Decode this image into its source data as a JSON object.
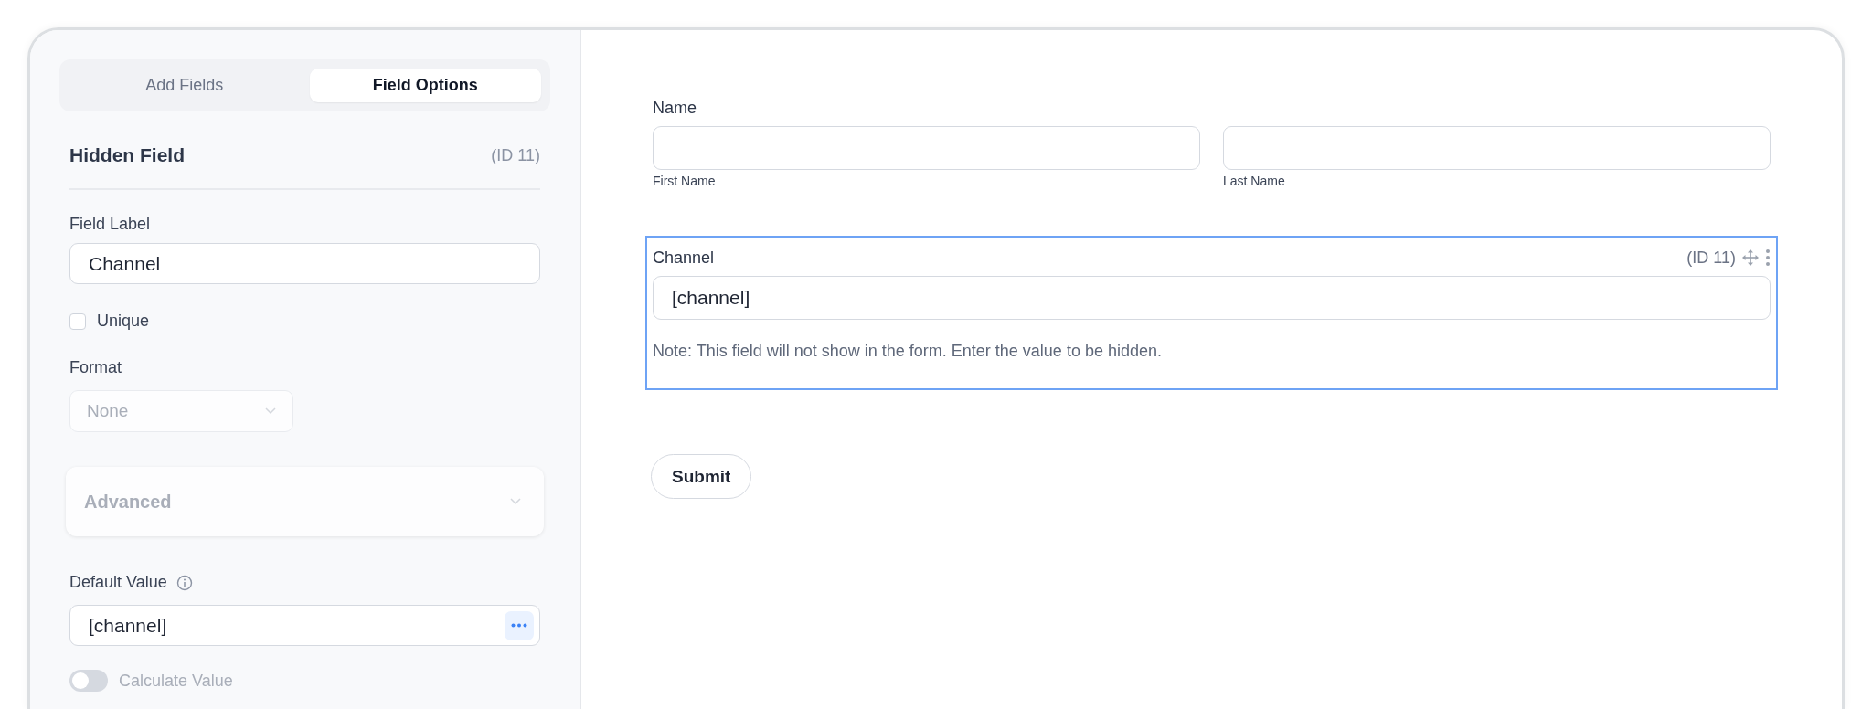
{
  "sidebar": {
    "tabs": [
      {
        "label": "Add Fields",
        "selected": false
      },
      {
        "label": "Field Options",
        "selected": true
      }
    ],
    "field_title": "Hidden Field",
    "field_id": "(ID 11)",
    "field_label": {
      "label": "Field Label",
      "value": "Channel"
    },
    "unique": {
      "label": "Unique",
      "checked": false
    },
    "format": {
      "label": "Format",
      "value": "None",
      "disabled": true
    },
    "advanced": {
      "label": "Advanced",
      "expanded": false,
      "disabled": true
    },
    "default_value": {
      "label": "Default Value",
      "value": "[channel]"
    },
    "calculate_value": {
      "label": "Calculate Value",
      "on": false
    }
  },
  "form": {
    "fields": [
      {
        "kind": "name",
        "label": "Name",
        "selected": false,
        "subfields": [
          {
            "sublabel": "First Name"
          },
          {
            "sublabel": "Last Name"
          }
        ]
      },
      {
        "kind": "hidden",
        "label": "Channel",
        "selected": true,
        "id": "(ID 11)",
        "value": "[channel]",
        "note": "Note: This field will not show in the form. Enter the value to be hidden."
      }
    ],
    "submit": "Submit"
  }
}
